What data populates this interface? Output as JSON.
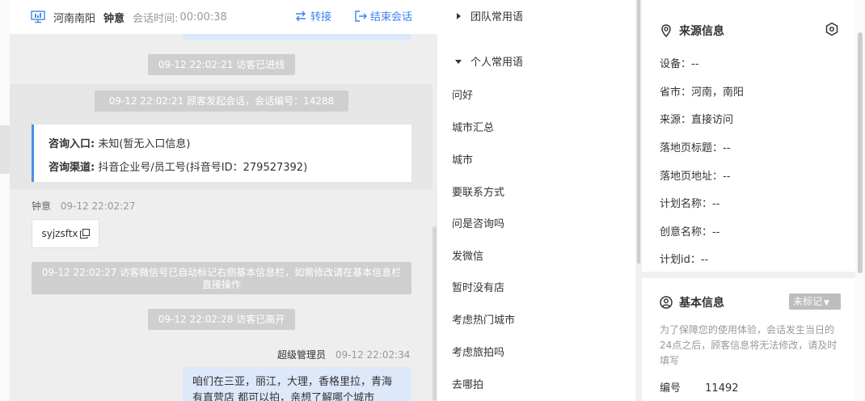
{
  "header": {
    "region": "河南南阳",
    "agent_name": "钟意",
    "time_label": "会话时间:",
    "time_value": "00:00:38",
    "transfer_label": "转接",
    "end_label": "结束会话"
  },
  "chat": {
    "sys_entered": "09-12 22:02:21 访客已进线",
    "sys_session": "09-12 22:02:21 顾客发起会话，会话编号：14288",
    "entry_label": "咨询入口:",
    "entry_value": "未知(暂无入口信息)",
    "channel_label": "咨询渠道:",
    "channel_value": "抖音企业号/员工号(抖音号ID：279527392)",
    "msg1_sender": "钟意",
    "msg1_time": "09-12 22:02:27",
    "msg1_text": "syjzsftx",
    "sys_wechat": "09-12 22:02:27 访客微信号已自动标记右侧基本信息栏，如需修改请在基本信息栏直接操作",
    "sys_left": "09-12 22:02:28 访客已离开",
    "msg2_sender": "超级管理员",
    "msg2_time": "09-12 22:02:34",
    "msg2_text": "咱们在三亚，丽江，大理，香格里拉，青海有直营店 都可以拍，亲想了解哪个城市"
  },
  "phrases": {
    "team_group": "团队常用语",
    "personal_group": "个人常用语",
    "items": [
      "问好",
      "城市汇总",
      "城市",
      "要联系方式",
      "问是咨询吗",
      "发微信",
      "暂时没有店",
      "考虑热门城市",
      "考虑旅拍吗",
      "去哪拍"
    ]
  },
  "source": {
    "title": "来源信息",
    "rows": [
      "设备：--",
      "省市：河南，南阳",
      "来源：直接访问",
      "落地页标题：--",
      "落地页地址：--",
      "计划名称：--",
      "创意名称：--",
      "计划id：--"
    ]
  },
  "basic": {
    "title": "基本信息",
    "tag_label": "未标记",
    "notice": "为了保障您的使用体验，会话发生当日的24点之后，顾客信息将无法修改，请及时填写",
    "code_label": "编号",
    "code_value": "11492"
  },
  "colors": {
    "accent": "#3b82f6",
    "card_border": "#4a90e2",
    "bubble": "#dde8fb",
    "sys_pill": "#cfcfcf"
  }
}
